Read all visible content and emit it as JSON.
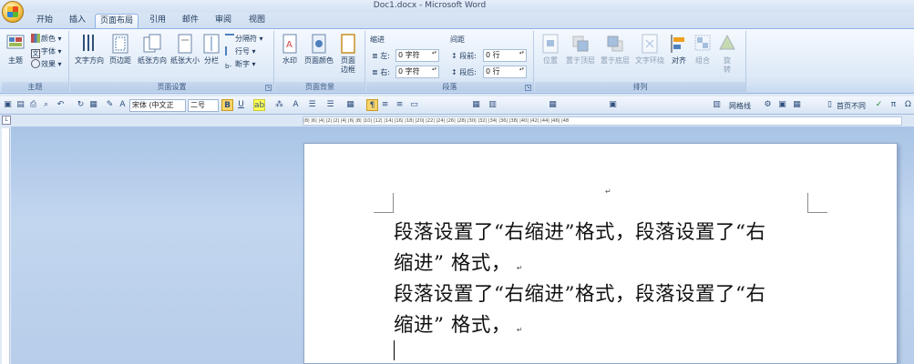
{
  "window": {
    "title": "Doc1.docx - Microsoft Word"
  },
  "tabs": [
    "开始",
    "插入",
    "页面布局",
    "引用",
    "邮件",
    "审阅",
    "视图"
  ],
  "active_tab": "页面布局",
  "ribbon": {
    "themes": {
      "label": "主题",
      "big": "主题",
      "items": [
        "颜色",
        "字体",
        "效果"
      ]
    },
    "page_setup": {
      "label": "页面设置",
      "buttons": [
        "文字方向",
        "页边距",
        "纸张方向",
        "纸张大小",
        "分栏"
      ],
      "items": [
        "分隔符",
        "行号",
        "断字"
      ]
    },
    "page_bg": {
      "label": "页面背景",
      "buttons": [
        "水印",
        "页面颜色",
        "页面\n边框"
      ]
    },
    "paragraph": {
      "label": "段落",
      "indent": "缩进",
      "spacing": "间距",
      "left": "左:",
      "right": "右:",
      "before": "段前:",
      "after": "段后:",
      "left_val": "0 字符",
      "right_val": "0 字符",
      "before_val": "0 行",
      "after_val": "0 行"
    },
    "arrange": {
      "label": "排列",
      "buttons": [
        "位置",
        "置于顶层",
        "置于底层",
        "文字环绕",
        "对齐",
        "组合",
        "旋\n转"
      ]
    }
  },
  "toolbar": {
    "font": "宋体 (中文正",
    "size": "二号",
    "gridlines": "网格线",
    "page_nav": "首页不同",
    "bold": "B",
    "underline": "U",
    "pi": "π"
  },
  "ruler": {
    "h_marks": "|8| |6| |4| |2|  |2| |4| |6| |8| |10| |12| |14| |16| |18| |20| |22| |24| |26| |28| |30| |32| |34| |36| |38| |40| |42| |44| |46| |48"
  },
  "document": {
    "lines": [
      "段落设置了“右缩进”格式，段落设置了“右",
      "缩进” 格式，",
      "段落设置了“右缩进”格式，段落设置了“右",
      "缩进” 格式，"
    ],
    "para_mark": "↵"
  },
  "colors": {
    "ribbon": "#dde9f7",
    "accent": "#8db2e3",
    "page": "#ffffff",
    "workspace": "#b7cde9"
  }
}
